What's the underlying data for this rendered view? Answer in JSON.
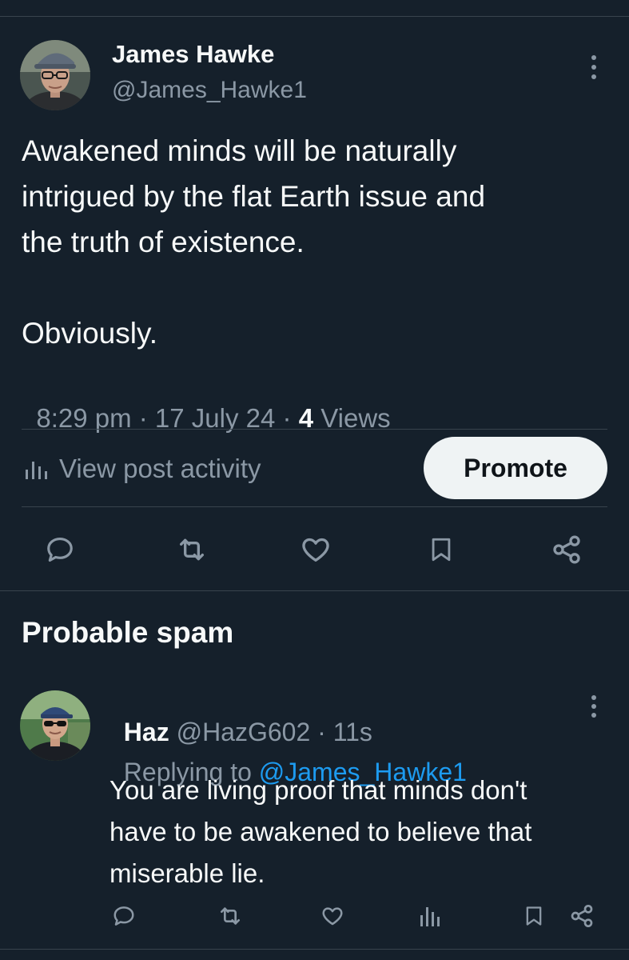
{
  "post": {
    "author": {
      "name": "James Hawke",
      "handle": "@James_Hawke1",
      "avatar": "avatar-james-hawke"
    },
    "text_lines": [
      "Awakened minds will be naturally",
      "intrigued by the flat Earth issue and",
      "the truth of existence."
    ],
    "text_final": "Obviously.",
    "time": "8:29 pm",
    "sep1": " · ",
    "date": "17 July 24",
    "sep2": " · ",
    "views_count": "4",
    "views_label": " Views",
    "activity_label": "View post activity",
    "promote_label": "Promote",
    "actions": [
      "reply-icon",
      "retweet-icon",
      "like-icon",
      "bookmark-icon",
      "share-icon"
    ]
  },
  "section": {
    "title": "Probable spam"
  },
  "reply": {
    "author": {
      "name": "Haz",
      "handle": "@HazG602",
      "sep": " · ",
      "time": "11s",
      "avatar": "avatar-haz"
    },
    "replying_prefix": "Replying to ",
    "replying_handle": "@James_Hawke1",
    "text_lines": [
      "You are living proof that minds don't",
      "have to be awakened to believe that",
      "miserable lie."
    ],
    "actions": [
      "reply-icon",
      "retweet-icon",
      "like-icon",
      "views-icon",
      "bookmark-icon",
      "share-icon"
    ]
  },
  "colors": {
    "background": "#15202b",
    "text": "#f7f9f9",
    "secondary": "#8b98a5",
    "accent": "#1d9bf0",
    "divider": "#38444d"
  }
}
